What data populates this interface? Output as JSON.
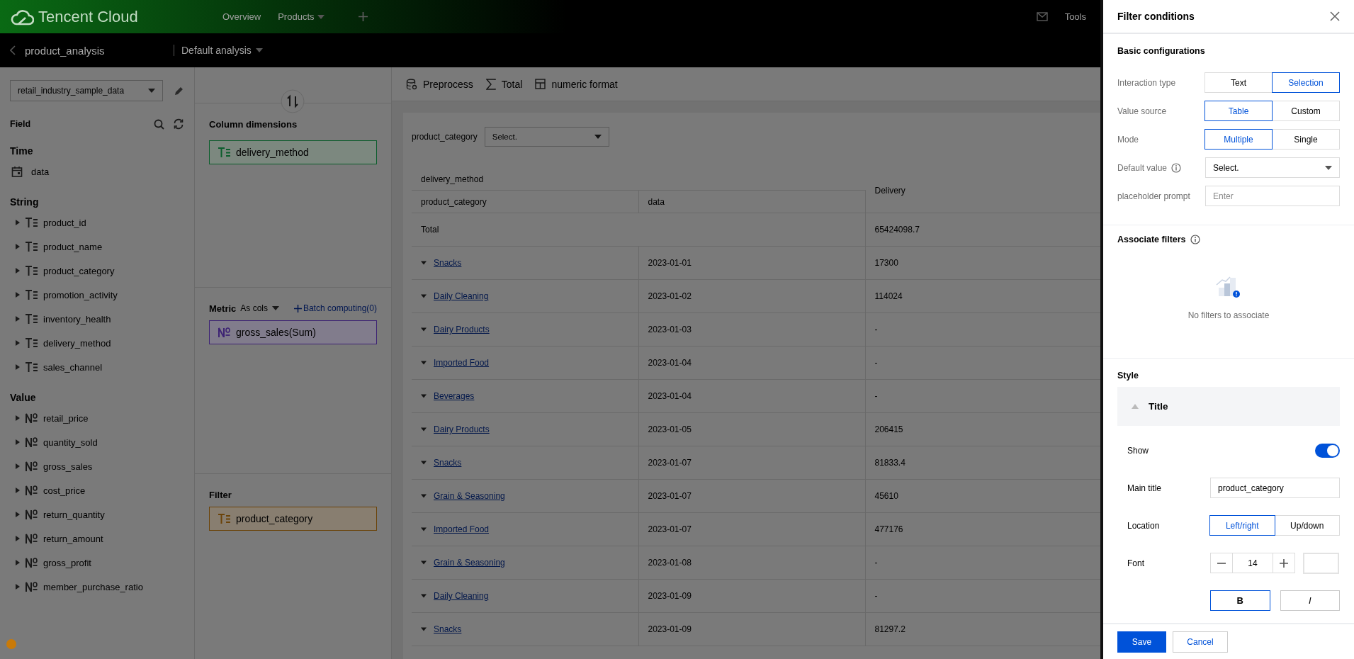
{
  "top_bar": {
    "brand": "Tencent Cloud",
    "nav": [
      {
        "label": "Overview",
        "kind": "link"
      },
      {
        "label": "Products",
        "kind": "menu"
      }
    ],
    "tools": "Tools"
  },
  "sub_bar": {
    "title": "product_analysis",
    "view": "Default analysis"
  },
  "data_panel": {
    "dataset": "retail_industry_sample_data",
    "field_heading": "Field",
    "groups": [
      {
        "title": "Time",
        "fields": [
          {
            "name": "data",
            "kind": "date"
          }
        ]
      },
      {
        "title": "String",
        "fields": [
          {
            "name": "product_id",
            "kind": "text"
          },
          {
            "name": "product_name",
            "kind": "text"
          },
          {
            "name": "product_category",
            "kind": "text"
          },
          {
            "name": "promotion_activity",
            "kind": "text"
          },
          {
            "name": "inventory_health",
            "kind": "text"
          },
          {
            "name": "delivery_method",
            "kind": "text"
          },
          {
            "name": "sales_channel",
            "kind": "text"
          }
        ]
      },
      {
        "title": "Value",
        "fields": [
          {
            "name": "retail_price",
            "kind": "number"
          },
          {
            "name": "quantity_sold",
            "kind": "number"
          },
          {
            "name": "gross_sales",
            "kind": "number"
          },
          {
            "name": "cost_price",
            "kind": "number"
          },
          {
            "name": "return_quantity",
            "kind": "number"
          },
          {
            "name": "return_amount",
            "kind": "number"
          },
          {
            "name": "gross_profit",
            "kind": "number"
          },
          {
            "name": "member_purchase_ratio",
            "kind": "number"
          }
        ]
      }
    ]
  },
  "config_panel": {
    "sections": [
      {
        "title": "Column dimensions",
        "kind": "dimension",
        "chips": [
          {
            "name": "delivery_method",
            "kind": "text"
          }
        ]
      },
      {
        "title": "Metric",
        "kind": "metric",
        "mode": "As cols",
        "action": "Batch computing(0)",
        "chips": [
          {
            "name": "gross_sales(Sum)",
            "kind": "number"
          }
        ]
      },
      {
        "title": "Filter",
        "kind": "filter",
        "chips": [
          {
            "name": "product_category",
            "kind": "text"
          }
        ]
      }
    ]
  },
  "toolbar": [
    {
      "label": "Preprocess",
      "kind": "preprocess"
    },
    {
      "label": "Total",
      "kind": "total"
    },
    {
      "label": "numeric format",
      "kind": "format"
    }
  ],
  "filter_bar": {
    "label": "product_category",
    "prompt": "Select."
  },
  "table": {
    "column_dimension": "delivery_method",
    "row_headers": [
      "product_category",
      "data"
    ],
    "columns": [
      "Delivery"
    ],
    "total": {
      "label": "Total",
      "values": [
        "65424098.7"
      ]
    },
    "rows": [
      {
        "category": "Snacks",
        "date": "2023-01-01",
        "values": [
          "17300"
        ]
      },
      {
        "category": "Daily Cleaning",
        "date": "2023-01-02",
        "values": [
          "114024"
        ]
      },
      {
        "category": "Dairy Products",
        "date": "2023-01-03",
        "values": [
          "-"
        ]
      },
      {
        "category": "Imported Food",
        "date": "2023-01-04",
        "values": [
          "-"
        ]
      },
      {
        "category": "Beverages",
        "date": "2023-01-04",
        "values": [
          "-"
        ]
      },
      {
        "category": "Dairy Products",
        "date": "2023-01-05",
        "values": [
          "206415"
        ]
      },
      {
        "category": "Snacks",
        "date": "2023-01-07",
        "values": [
          "81833.4"
        ]
      },
      {
        "category": "Grain & Seasoning",
        "date": "2023-01-07",
        "values": [
          "45610"
        ]
      },
      {
        "category": "Imported Food",
        "date": "2023-01-07",
        "values": [
          "477176"
        ]
      },
      {
        "category": "Grain & Seasoning",
        "date": "2023-01-08",
        "values": [
          "-"
        ]
      },
      {
        "category": "Daily Cleaning",
        "date": "2023-01-09",
        "values": [
          "-"
        ]
      },
      {
        "category": "Snacks",
        "date": "2023-01-09",
        "values": [
          "81297.2"
        ]
      }
    ]
  },
  "drawer": {
    "title": "Filter conditions",
    "basic": {
      "title": "Basic configurations",
      "rows": [
        {
          "label": "Interaction type",
          "kind": "segmented",
          "options": [
            {
              "label": "Text",
              "selected": false
            },
            {
              "label": "Selection",
              "selected": true
            }
          ]
        },
        {
          "label": "Value source",
          "kind": "segmented",
          "options": [
            {
              "label": "Table",
              "selected": true
            },
            {
              "label": "Custom",
              "selected": false
            }
          ]
        },
        {
          "label": "Mode",
          "kind": "segmented",
          "options": [
            {
              "label": "Multiple",
              "selected": true
            },
            {
              "label": "Single",
              "selected": false
            }
          ]
        },
        {
          "label": "Default value",
          "kind": "select",
          "info": true,
          "value": "Select."
        },
        {
          "label": "placeholder prompt",
          "kind": "input",
          "placeholder": "Enter"
        }
      ]
    },
    "associate": {
      "title": "Associate filters",
      "empty": "No filters to associate"
    },
    "style": {
      "title": "Style",
      "group": {
        "title": "Title",
        "expanded": true,
        "rows": [
          {
            "label": "Show",
            "kind": "switch",
            "on": true
          },
          {
            "label": "Main title",
            "kind": "input",
            "value": "product_category"
          },
          {
            "label": "Location",
            "kind": "segmented",
            "options": [
              {
                "label": "Left/right",
                "selected": true
              },
              {
                "label": "Up/down",
                "selected": false
              }
            ]
          },
          {
            "label": "Font",
            "kind": "stepper",
            "value": "14"
          },
          {
            "kind": "toggles",
            "options": [
              {
                "label": "B",
                "kind": "bold",
                "selected": true
              },
              {
                "label": "I",
                "kind": "italic",
                "selected": false
              }
            ]
          }
        ]
      }
    },
    "buttons": [
      {
        "label": "Save",
        "kind": "primary"
      },
      {
        "label": "Cancel",
        "kind": "secondary"
      }
    ]
  }
}
